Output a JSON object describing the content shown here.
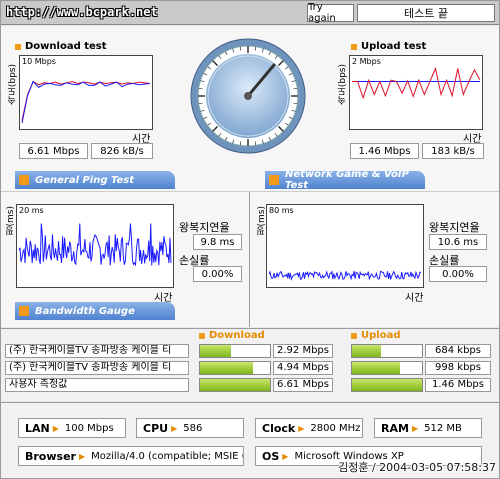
{
  "header": {
    "url": "http://www.bcpark.net",
    "try_again": "Try again",
    "status_button": "테스트 끝"
  },
  "download_test": {
    "title": "Download test",
    "y_label": "속도(bps)",
    "y_scale": "10 Mbps",
    "x_label": "시간",
    "speed": "6.61 Mbps",
    "rate": "826 kB/s",
    "series": [
      0.1,
      0.5,
      0.7,
      0.65,
      0.68,
      0.67,
      0.69,
      0.66,
      0.68,
      0.7,
      0.67,
      0.69,
      0.68,
      0.66,
      0.69,
      0.67,
      0.68,
      0.69,
      0.66,
      0.68,
      0.67,
      0.69,
      0.68,
      0.67
    ]
  },
  "upload_test": {
    "title": "Upload test",
    "y_label": "속도(bps)",
    "y_scale": "2 Mbps",
    "x_label": "시간",
    "speed": "1.46 Mbps",
    "rate": "183 kB/s",
    "series": [
      0.7,
      0.7,
      0.45,
      0.72,
      0.5,
      0.7,
      0.48,
      0.72,
      0.7,
      0.52,
      0.71,
      0.47,
      0.72,
      0.5,
      0.7,
      0.9,
      0.5,
      0.72,
      0.48,
      0.9,
      0.5,
      0.7,
      0.88,
      0.72
    ]
  },
  "sections": {
    "ping": "General Ping Test",
    "game": "Network Game & VoIP Test",
    "bandwidth": "Bandwidth Gauge"
  },
  "ping_general": {
    "y_label": "핑(ms)",
    "y_scale": "20 ms",
    "x_label": "시간",
    "rtt_label": "왕복지연율",
    "rtt": "9.8 ms",
    "loss_label": "손실률",
    "loss": "0.00%"
  },
  "ping_game": {
    "y_label": "핑(ms)",
    "y_scale": "80 ms",
    "x_label": "시간",
    "rtt_label": "왕복지연율",
    "rtt": "10.6 ms",
    "loss_label": "손실률",
    "loss": "0.00%"
  },
  "gauge": {
    "download_label": "Download",
    "upload_label": "Upload",
    "rows": [
      {
        "isp": "(주) 한국케이블TV 송파방송 케이블 티",
        "down": "2.92 Mbps",
        "down_frac": 0.44,
        "up": "684 kbps",
        "up_frac": 0.42
      },
      {
        "isp": "(주) 한국케이블TV 송파방송 케이블 티",
        "down": "4.94 Mbps",
        "down_frac": 0.75,
        "up": "998 kbps",
        "up_frac": 0.68
      },
      {
        "isp": "사용자 측정값",
        "down": "6.61 Mbps",
        "down_frac": 1.0,
        "up": "1.46 Mbps",
        "up_frac": 1.0
      }
    ]
  },
  "system": {
    "lan_label": "LAN",
    "lan": "100 Mbps",
    "cpu_label": "CPU",
    "cpu": "586",
    "clock_label": "Clock",
    "clock": "2800 MHz",
    "ram_label": "RAM",
    "ram": "512 MB",
    "browser_label": "Browser",
    "browser": "Mozilla/4.0 (compatible; MSIE 6.0",
    "os_label": "OS",
    "os": "Microsoft Windows XP"
  },
  "stamp": "김정훈 / 2004-03-05 07:58:37",
  "colors": {
    "accent": "#f39a1a",
    "bar_blue": "#4f82cf",
    "gauge_green": "#7fb51b",
    "line_blue": "#1a1aff",
    "line_red": "#e0102a"
  }
}
